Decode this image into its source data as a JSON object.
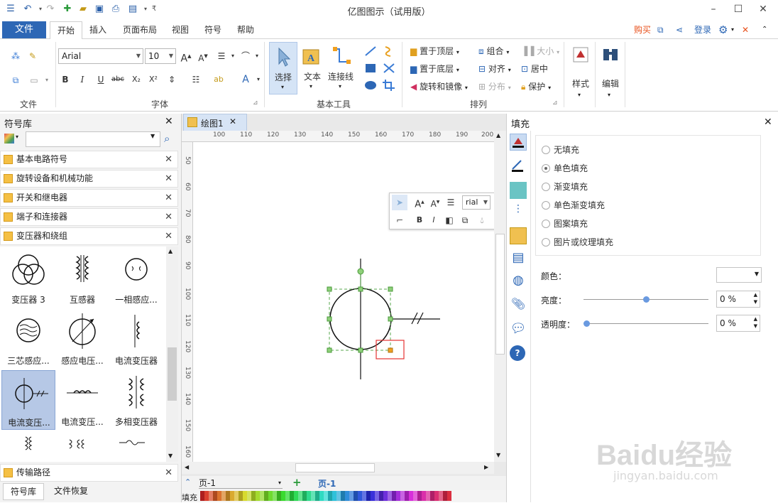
{
  "app": {
    "title": "亿图图示（试用版）"
  },
  "menu": {
    "file": "文件",
    "tabs": [
      "开始",
      "插入",
      "页面布局",
      "视图",
      "符号",
      "帮助"
    ],
    "buy": "购买",
    "login": "登录"
  },
  "ribbon": {
    "groups": {
      "file": "文件",
      "font": "字体",
      "basic_tools": "基本工具",
      "arrange": "排列"
    },
    "font_name": "Arial",
    "font_size": "10",
    "tools": {
      "select": "选择",
      "text": "文本",
      "connector": "连接线"
    },
    "arrange": {
      "bring_front": "置于顶层",
      "send_back": "置于底层",
      "rotate_mirror": "旋转和镜像",
      "group": "组合",
      "align": "对齐",
      "distribute": "分布",
      "size": "大小",
      "center": "居中",
      "protect": "保护"
    },
    "style": "样式",
    "edit": "编辑"
  },
  "symbol_library": {
    "title": "符号库",
    "search_placeholder": "",
    "categories": [
      "基本电路符号",
      "旋转设备和机械功能",
      "开关和继电器",
      "端子和连接器",
      "变压器和绕组"
    ],
    "symbols": [
      [
        "变压器 3",
        "互感器",
        "一相感应..."
      ],
      [
        "三芯感应...",
        "感应电压...",
        "电流变压器"
      ],
      [
        "电流变压...",
        "电流变压...",
        "多相变压器"
      ]
    ],
    "bottom_category": "传输路径",
    "bottom_tabs": [
      "符号库",
      "文件恢复"
    ]
  },
  "canvas": {
    "doc_tab": "绘图1",
    "ruler_h": [
      "100",
      "110",
      "120",
      "130",
      "140",
      "150",
      "160",
      "170",
      "180",
      "190",
      "200"
    ],
    "ruler_v": [
      "50",
      "60",
      "70",
      "80",
      "90",
      "100",
      "110",
      "120",
      "130",
      "140",
      "150",
      "160"
    ],
    "mini_font": "rial",
    "page_selector": "页-1",
    "page_tab": "页-1",
    "fill_label": "填充"
  },
  "fill_panel": {
    "title": "填充",
    "options": [
      "无填充",
      "单色填充",
      "渐变填充",
      "单色渐变填充",
      "图案填充",
      "图片或纹理填充"
    ],
    "selected_option": "单色填充",
    "color_label": "颜色：",
    "brightness_label": "亮度：",
    "brightness_value": "0 %",
    "transparency_label": "透明度：",
    "transparency_value": "0 %"
  },
  "watermark": {
    "brand": "Baidu经验",
    "url": "jingyan.baidu.com"
  },
  "colors": {
    "accent": "#2d67b5",
    "buy": "#e8511c",
    "selection": "#5aa84f",
    "highlight": "#e53333"
  }
}
